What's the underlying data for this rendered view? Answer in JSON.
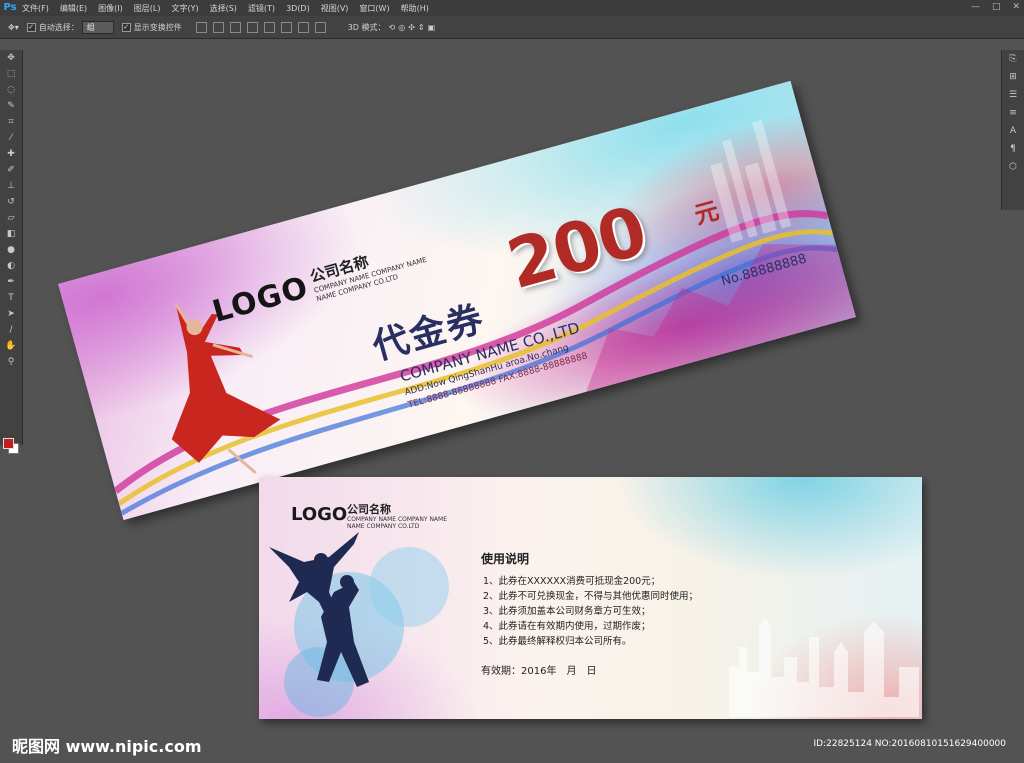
{
  "app": {
    "logo": "Ps"
  },
  "menu": [
    "文件(F)",
    "编辑(E)",
    "图像(I)",
    "图层(L)",
    "文字(Y)",
    "选择(S)",
    "滤镜(T)",
    "3D(D)",
    "视图(V)",
    "窗口(W)",
    "帮助(H)"
  ],
  "window_controls": [
    "—",
    "□",
    "✕"
  ],
  "options_bar": {
    "auto_select_label": "自动选择：",
    "auto_select_value": "组",
    "show_transform_label": "显示变换控件",
    "mode_3d_label": "3D 模式："
  },
  "colors": {
    "foreground": "#c31d1d",
    "background": "#ffffff",
    "workspace": "#535353",
    "amount": "#b02b26",
    "title": "#2a2f63"
  },
  "front_card": {
    "logo": "LOGO",
    "company_cn": "公司名称",
    "company_en_line1": "COMPANY NAME COMPANY NAME",
    "company_en_line2": "NAME COMPANY CO.LTD",
    "title": "代金券",
    "amount": "200",
    "unit": "元",
    "company_name": "COMPANY NAME CO.,LTD",
    "address": "ADD:Now QingShanHu aroa.No.chang",
    "tel_fax": "TEL:8888-88888888   FAX:8888-88888888",
    "serial": "No.88888888"
  },
  "back_card": {
    "logo": "LOGO",
    "company_cn": "公司名称",
    "company_en_line1": "COMPANY NAME COMPANY NAME",
    "company_en_line2": "NAME COMPANY CO.LTD",
    "heading": "使用说明",
    "rules": [
      "1、此券在XXXXXX消费可抵现金200元；",
      "2、此券不可兑换现金，不得与其他优惠同时使用；",
      "3、此券须加盖本公司财务章方可生效；",
      "4、此券请在有效期内使用，过期作废；",
      "5、此券最终解释权归本公司所有。"
    ],
    "validity": "有效期：2016年　月　日"
  },
  "watermark": {
    "site": "昵图网 www.nipic.com",
    "id": "ID:22825124 NO:20160810151629400000"
  }
}
